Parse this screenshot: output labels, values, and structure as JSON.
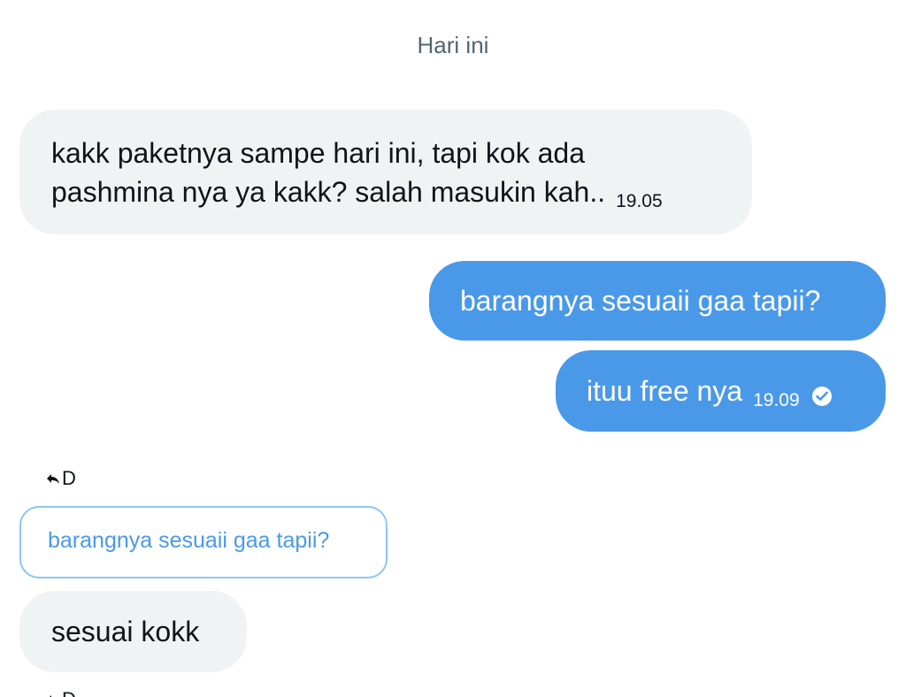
{
  "date_separator": "Hari ini",
  "messages": [
    {
      "direction": "incoming",
      "lines": [
        "kakk paketnya sampe hari ini, tapi kok ada",
        "pashmina nya ya kakk? salah masukin kah.."
      ],
      "time": "19.05"
    },
    {
      "direction": "outgoing",
      "text": "barangnya sesuaii gaa tapii?"
    },
    {
      "direction": "outgoing",
      "text": "ituu free nya",
      "time": "19.09",
      "status_icon": "read-check-icon"
    }
  ],
  "reply_block": {
    "reply_icon": "reply-arrow-icon",
    "reply_to_name": "D",
    "quoted_text": "barangnya sesuaii gaa tapii?",
    "reply_text": "sesuai kokk"
  },
  "partial_next_reply": {
    "reply_to_name": "D"
  },
  "colors": {
    "outgoing_bubble": "#4a99e9",
    "incoming_bubble": "#eff3f4",
    "quote_border": "#8ec5f2",
    "muted_text": "#536471"
  }
}
